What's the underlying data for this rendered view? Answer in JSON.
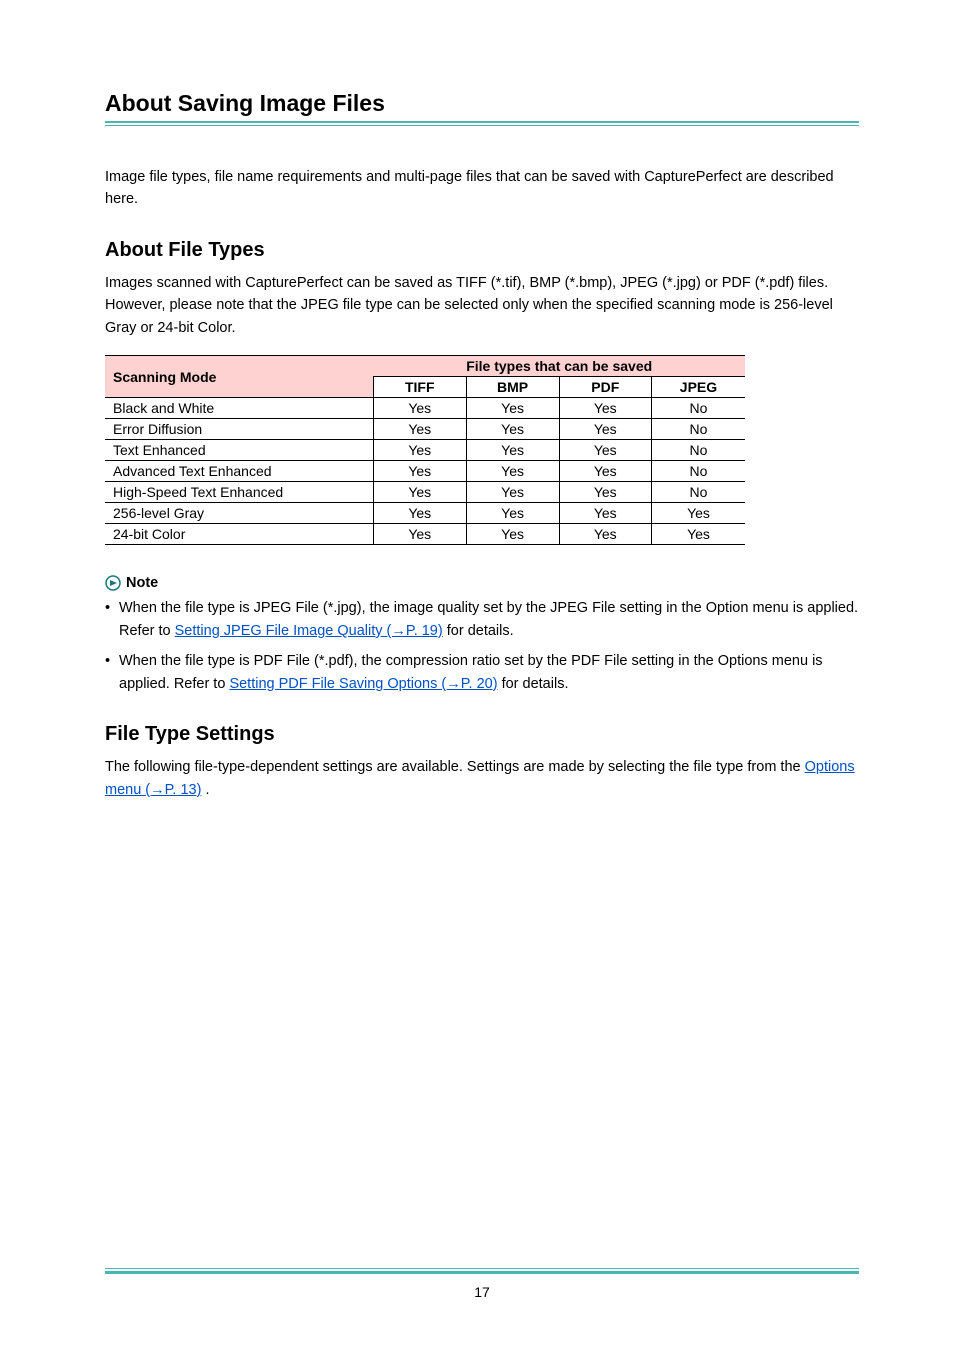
{
  "title": "About Saving Image Files",
  "intro": "Image file types, file name requirements and multi-page files that can be saved with CapturePerfect are described here.",
  "section1": {
    "heading": "About File Types",
    "body": "Images scanned with CapturePerfect can be saved as TIFF (*.tif), BMP (*.bmp), JPEG (*.jpg) or PDF (*.pdf) files. However, please note that the JPEG file type can be selected only when the specified scanning mode is 256-level Gray or 24-bit Color."
  },
  "table": {
    "h_scanning": "Scanning Mode",
    "h_filetypes": "File types that can be saved",
    "cols": [
      "TIFF",
      "BMP",
      "PDF",
      "JPEG"
    ],
    "rows": [
      {
        "label": "Black and White",
        "cells": [
          "Yes",
          "Yes",
          "Yes",
          "No"
        ]
      },
      {
        "label": "Error Diffusion",
        "cells": [
          "Yes",
          "Yes",
          "Yes",
          "No"
        ]
      },
      {
        "label": "Text Enhanced",
        "cells": [
          "Yes",
          "Yes",
          "Yes",
          "No"
        ]
      },
      {
        "label": "Advanced Text Enhanced",
        "cells": [
          "Yes",
          "Yes",
          "Yes",
          "No"
        ]
      },
      {
        "label": "High-Speed Text Enhanced",
        "cells": [
          "Yes",
          "Yes",
          "Yes",
          "No"
        ]
      },
      {
        "label": "256-level Gray",
        "cells": [
          "Yes",
          "Yes",
          "Yes",
          "Yes"
        ]
      },
      {
        "label": "24-bit Color",
        "cells": [
          "Yes",
          "Yes",
          "Yes",
          "Yes"
        ]
      }
    ]
  },
  "note_label": "Note",
  "notes": {
    "n1_pre": "When the file type is JPEG File (*.jpg), the image quality set by the JPEG File setting in the Option menu is applied. Refer to ",
    "n1_link": "Setting JPEG File Image Quality (→P. 19)",
    "n1_post": " for details.",
    "n2_pre": "When the file type is PDF File (*.pdf), the compression ratio set by the PDF File setting in the Options menu is applied. Refer to ",
    "n2_link": "Setting PDF File Saving Options (→P. 20)",
    "n2_post": " for details."
  },
  "section2": {
    "heading": "File Type Settings",
    "body_pre": "The following file-type-dependent settings are available. Settings are made by selecting the file type from the ",
    "body_link": "Options menu (→P. 13)",
    "body_post": " ."
  },
  "page_number": "17"
}
